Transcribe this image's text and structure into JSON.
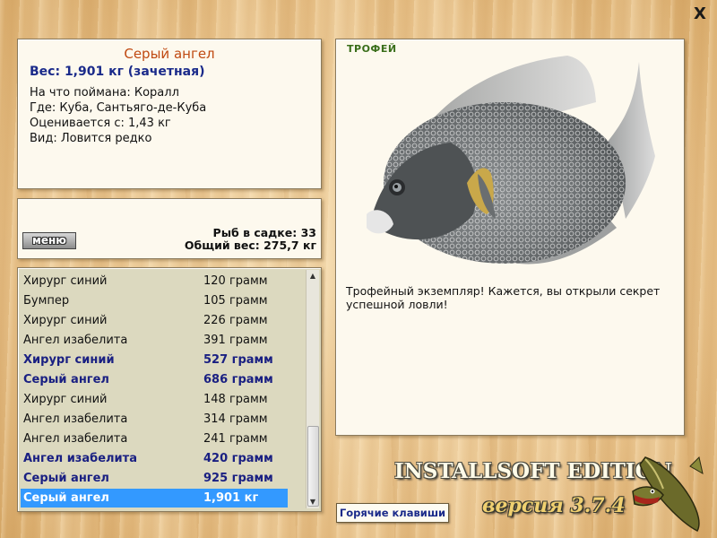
{
  "close_label": "X",
  "info": {
    "title": "Серый ангел",
    "weight": "Вес: 1,901 кг (зачетная)",
    "bait": "На что поймана: Коралл",
    "location": "Где: Куба, Сантьяго-де-Куба",
    "valued_from": "Оценивается с: 1,43 кг",
    "rarity": "Вид: Ловится редко"
  },
  "mid": {
    "menu_label": "меню",
    "fish_in_net": "Рыб в садке: 33",
    "total_weight": "Общий вес: 275,7 кг"
  },
  "catch_list": [
    {
      "name": "Хирург синий",
      "weight": "120 грамм",
      "bold": false
    },
    {
      "name": "Бумпер",
      "weight": "105 грамм",
      "bold": false
    },
    {
      "name": "Хирург синий",
      "weight": "226 грамм",
      "bold": false
    },
    {
      "name": "Ангел изабелита",
      "weight": "391 грамм",
      "bold": false
    },
    {
      "name": "Хирург синий",
      "weight": "527 грамм",
      "bold": true
    },
    {
      "name": "Серый ангел",
      "weight": "686 грамм",
      "bold": true
    },
    {
      "name": "Хирург синий",
      "weight": "148 грамм",
      "bold": false
    },
    {
      "name": "Ангел изабелита",
      "weight": "314 грамм",
      "bold": false
    },
    {
      "name": "Ангел изабелита",
      "weight": "241 грамм",
      "bold": false
    },
    {
      "name": "Ангел изабелита",
      "weight": "420 грамм",
      "bold": true
    },
    {
      "name": "Серый ангел",
      "weight": "925 грамм",
      "bold": true
    },
    {
      "name": "Серый ангел",
      "weight": "1,901 кг",
      "bold": true,
      "selected": true
    }
  ],
  "trophy": {
    "label": "ТРОФЕЙ",
    "message": "Трофейный экземпляр! Кажется, вы открыли секрет успешной ловли!"
  },
  "hotkeys_label": "Горячие клавиши",
  "brand": "INSTALLSOFT EDITION",
  "version": "версия 3.7.4",
  "colors": {
    "title": "#c04a12",
    "bold_row": "#1a2082",
    "selection": "#3399ff",
    "trophy_label": "#3a6e1a"
  }
}
